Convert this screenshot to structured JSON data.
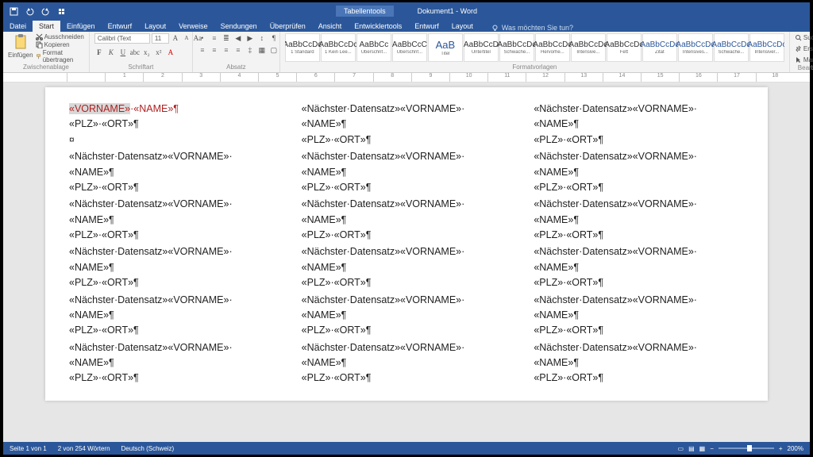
{
  "titlebar": {
    "context_tab": "Tabellentools",
    "doc_title": "Dokument1 - Word"
  },
  "tabs": [
    "Datei",
    "Start",
    "Einfügen",
    "Entwurf",
    "Layout",
    "Verweise",
    "Sendungen",
    "Überprüfen",
    "Ansicht",
    "Entwicklertools",
    "Entwurf",
    "Layout"
  ],
  "active_tab": 1,
  "tellme": "Was möchten Sie tun?",
  "clipboard": {
    "paste": "Einfügen",
    "cut": "Ausschneiden",
    "copy": "Kopieren",
    "format": "Format übertragen",
    "label": "Zwischenablage"
  },
  "font": {
    "name": "Calibri (Text",
    "size": "11",
    "label": "Schriftart"
  },
  "paragraph": {
    "label": "Absatz"
  },
  "styles": {
    "label": "Formatvorlagen",
    "items": [
      {
        "preview": "AaBbCcDc",
        "name": "1 Standard"
      },
      {
        "preview": "AaBbCcDc",
        "name": "1 Kein Lee..."
      },
      {
        "preview": "AaBbCc",
        "name": "Überschrif..."
      },
      {
        "preview": "AaBbCcC",
        "name": "Überschrif..."
      },
      {
        "preview": "AaB",
        "name": "Titel"
      },
      {
        "preview": "AaBbCcD",
        "name": "Untertitel"
      },
      {
        "preview": "AaBbCcDc",
        "name": "Schwache..."
      },
      {
        "preview": "AaBbCcDc",
        "name": "Hervorhe..."
      },
      {
        "preview": "AaBbCcDc",
        "name": "Intensive..."
      },
      {
        "preview": "AaBbCcDc",
        "name": "Fett"
      },
      {
        "preview": "AaBbCcDc",
        "name": "Zitat"
      },
      {
        "preview": "AaBbCcDc",
        "name": "Intensives..."
      },
      {
        "preview": "AaBbCcDc",
        "name": "Schwache..."
      },
      {
        "preview": "AaBbCcDc",
        "name": "Intensiver..."
      }
    ]
  },
  "editing": {
    "find": "Suchen",
    "replace": "Ersetzen",
    "select": "Markieren",
    "label": "Bearbeiten"
  },
  "merge": {
    "first_line1": "«VORNAME»·«NAME»¶",
    "first_sel": "«VORNAME»",
    "first_rest": "·«NAME»¶",
    "plz_line": "«PLZ»·«ORT»¶",
    "cell_mark": "¤",
    "next_line1": "«Nächster·Datensatz»«VORNAME»·",
    "next_line2": "«NAME»¶"
  },
  "status": {
    "page": "Seite 1 von 1",
    "words": "2 von 254 Wörtern",
    "lang": "Deutsch (Schweiz)",
    "zoom": "200%"
  }
}
